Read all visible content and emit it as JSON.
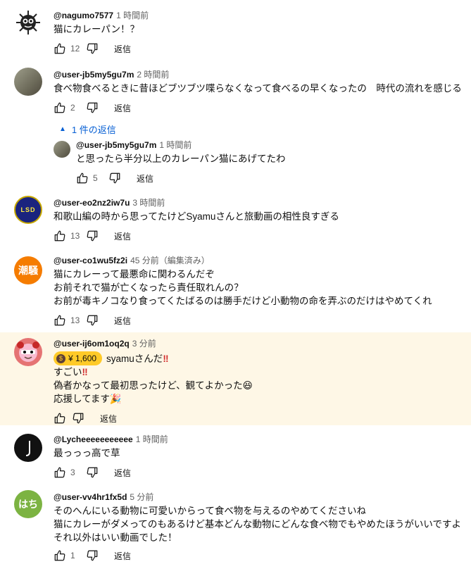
{
  "comments": [
    {
      "author": "@nagumo7577",
      "time": "1 時間前",
      "lines": [
        "猫にカレーパン！？"
      ],
      "likes": "12",
      "reply_label": "返信"
    },
    {
      "author": "@user-jb5my5gu7m",
      "time": "2 時間前",
      "lines": [
        "食べ物食べるときに昔ほどブツブツ喋らなくなって食べるの早くなったの　時代の流れを感じる"
      ],
      "likes": "2",
      "reply_label": "返信",
      "replies_toggle": "1 件の返信",
      "reply": {
        "author": "@user-jb5my5gu7m",
        "time": "1 時間前",
        "lines": [
          "と思ったら半分以上のカレーパン猫にあげてたわ"
        ],
        "likes": "5",
        "reply_label": "返信"
      }
    },
    {
      "author": "@user-eo2nz2iw7u",
      "time": "3 時間前",
      "lines": [
        "和歌山編の時から思ってたけどSyamuさんと旅動画の相性良すぎる"
      ],
      "likes": "13",
      "reply_label": "返信",
      "avatar_text": "LSD"
    },
    {
      "author": "@user-co1wu5fz2i",
      "time": "45 分前（編集済み）",
      "lines": [
        "猫にカレーって最悪命に関わるんだぞ",
        "お前それで猫が亡くなったら責任取れんの？",
        "お前が毒キノコなり食ってくたばるのは勝手だけど小動物の命を弄ぶのだけはやめてくれ"
      ],
      "likes": "13",
      "reply_label": "返信",
      "avatar_text": "潮騒"
    },
    {
      "author": "@user-ij6om1oq2q",
      "time": "3 分前",
      "superchat_amount": "¥ 1,600",
      "lines": [
        "syamuさんだ",
        "すごい",
        "偽者かなって最初思ったけど、観てよかった",
        "応援してます"
      ],
      "likes": "",
      "reply_label": "返信"
    },
    {
      "author": "@Lycheeeeeeeeeee",
      "time": "1 時間前",
      "lines": [
        "最っっっ高で草"
      ],
      "likes": "3",
      "reply_label": "返信"
    },
    {
      "author": "@user-vv4hr1fx5d",
      "time": "5 分前",
      "lines": [
        "そのへんにいる動物に可愛いからって食べ物を与えるのやめてくださいね",
        "猫にカレーがダメってのもあるけど基本どんな動物にどんな食べ物でもやめたほうがいいですよ",
        "それ以外はいい動画でした！"
      ],
      "likes": "1",
      "reply_label": "返信",
      "avatar_text": "はち"
    }
  ],
  "colors": {
    "link": "#065fd4",
    "superchat_bg": "#fef7e6",
    "badge": "#ffca28",
    "avatar_orange": "#f57c00",
    "avatar_green": "#7cb342",
    "avatar_navy": "#1a237e"
  }
}
